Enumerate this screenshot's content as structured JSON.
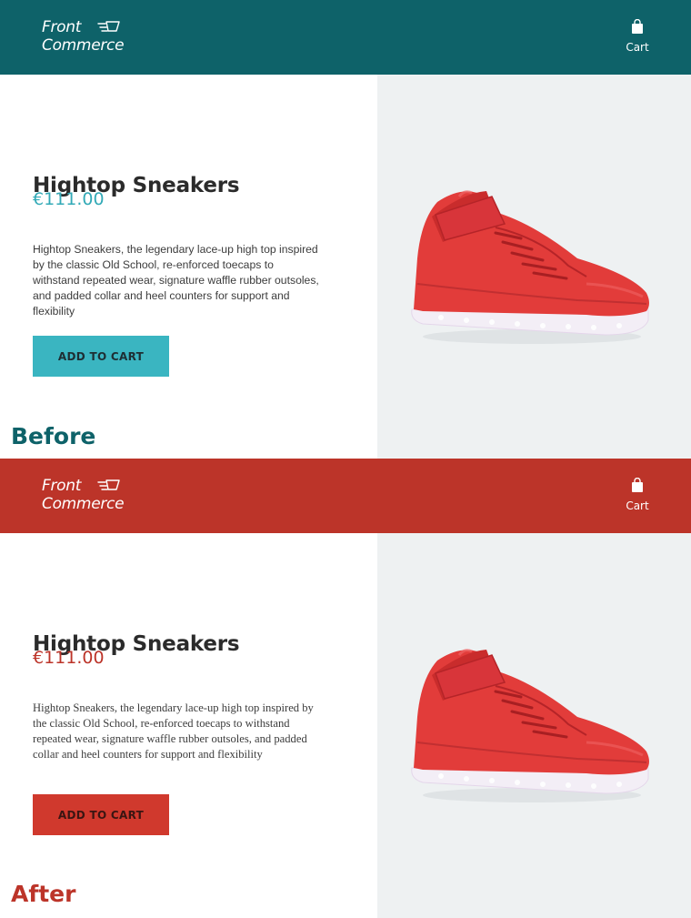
{
  "before": {
    "brand": {
      "line1": "Front",
      "line2": "Commerce"
    },
    "header": {
      "cart_label": "Cart",
      "background": "#0e6269"
    },
    "product": {
      "title": "Hightop Sneakers",
      "price": "€111.00",
      "description": "Hightop Sneakers, the legendary lace-up high top inspired by the classic Old School, re-enforced toecaps to withstand repeated wear, signature waffle rubber outsoles, and padded collar and heel counters for support and flexibility",
      "add_to_cart": "ADD TO CART"
    },
    "label": "Before",
    "accent": "#33aab7"
  },
  "after": {
    "brand": {
      "line1": "Front",
      "line2": "Commerce"
    },
    "header": {
      "cart_label": "Cart",
      "background": "#bc3429"
    },
    "product": {
      "title": "Hightop Sneakers",
      "price": "€111.00",
      "description": "Hightop Sneakers, the legendary lace-up high top inspired by the classic Old School, re-enforced toecaps to withstand repeated wear, signature waffle rubber outsoles, and padded collar and heel counters for support and flexibility",
      "add_to_cart": "ADD TO CART"
    },
    "label": "After",
    "accent": "#bc3429"
  },
  "icons": {
    "logo": "cart-speed-icon",
    "cart": "shopping-bag-icon",
    "product_image": "red-hightop-sneaker"
  }
}
